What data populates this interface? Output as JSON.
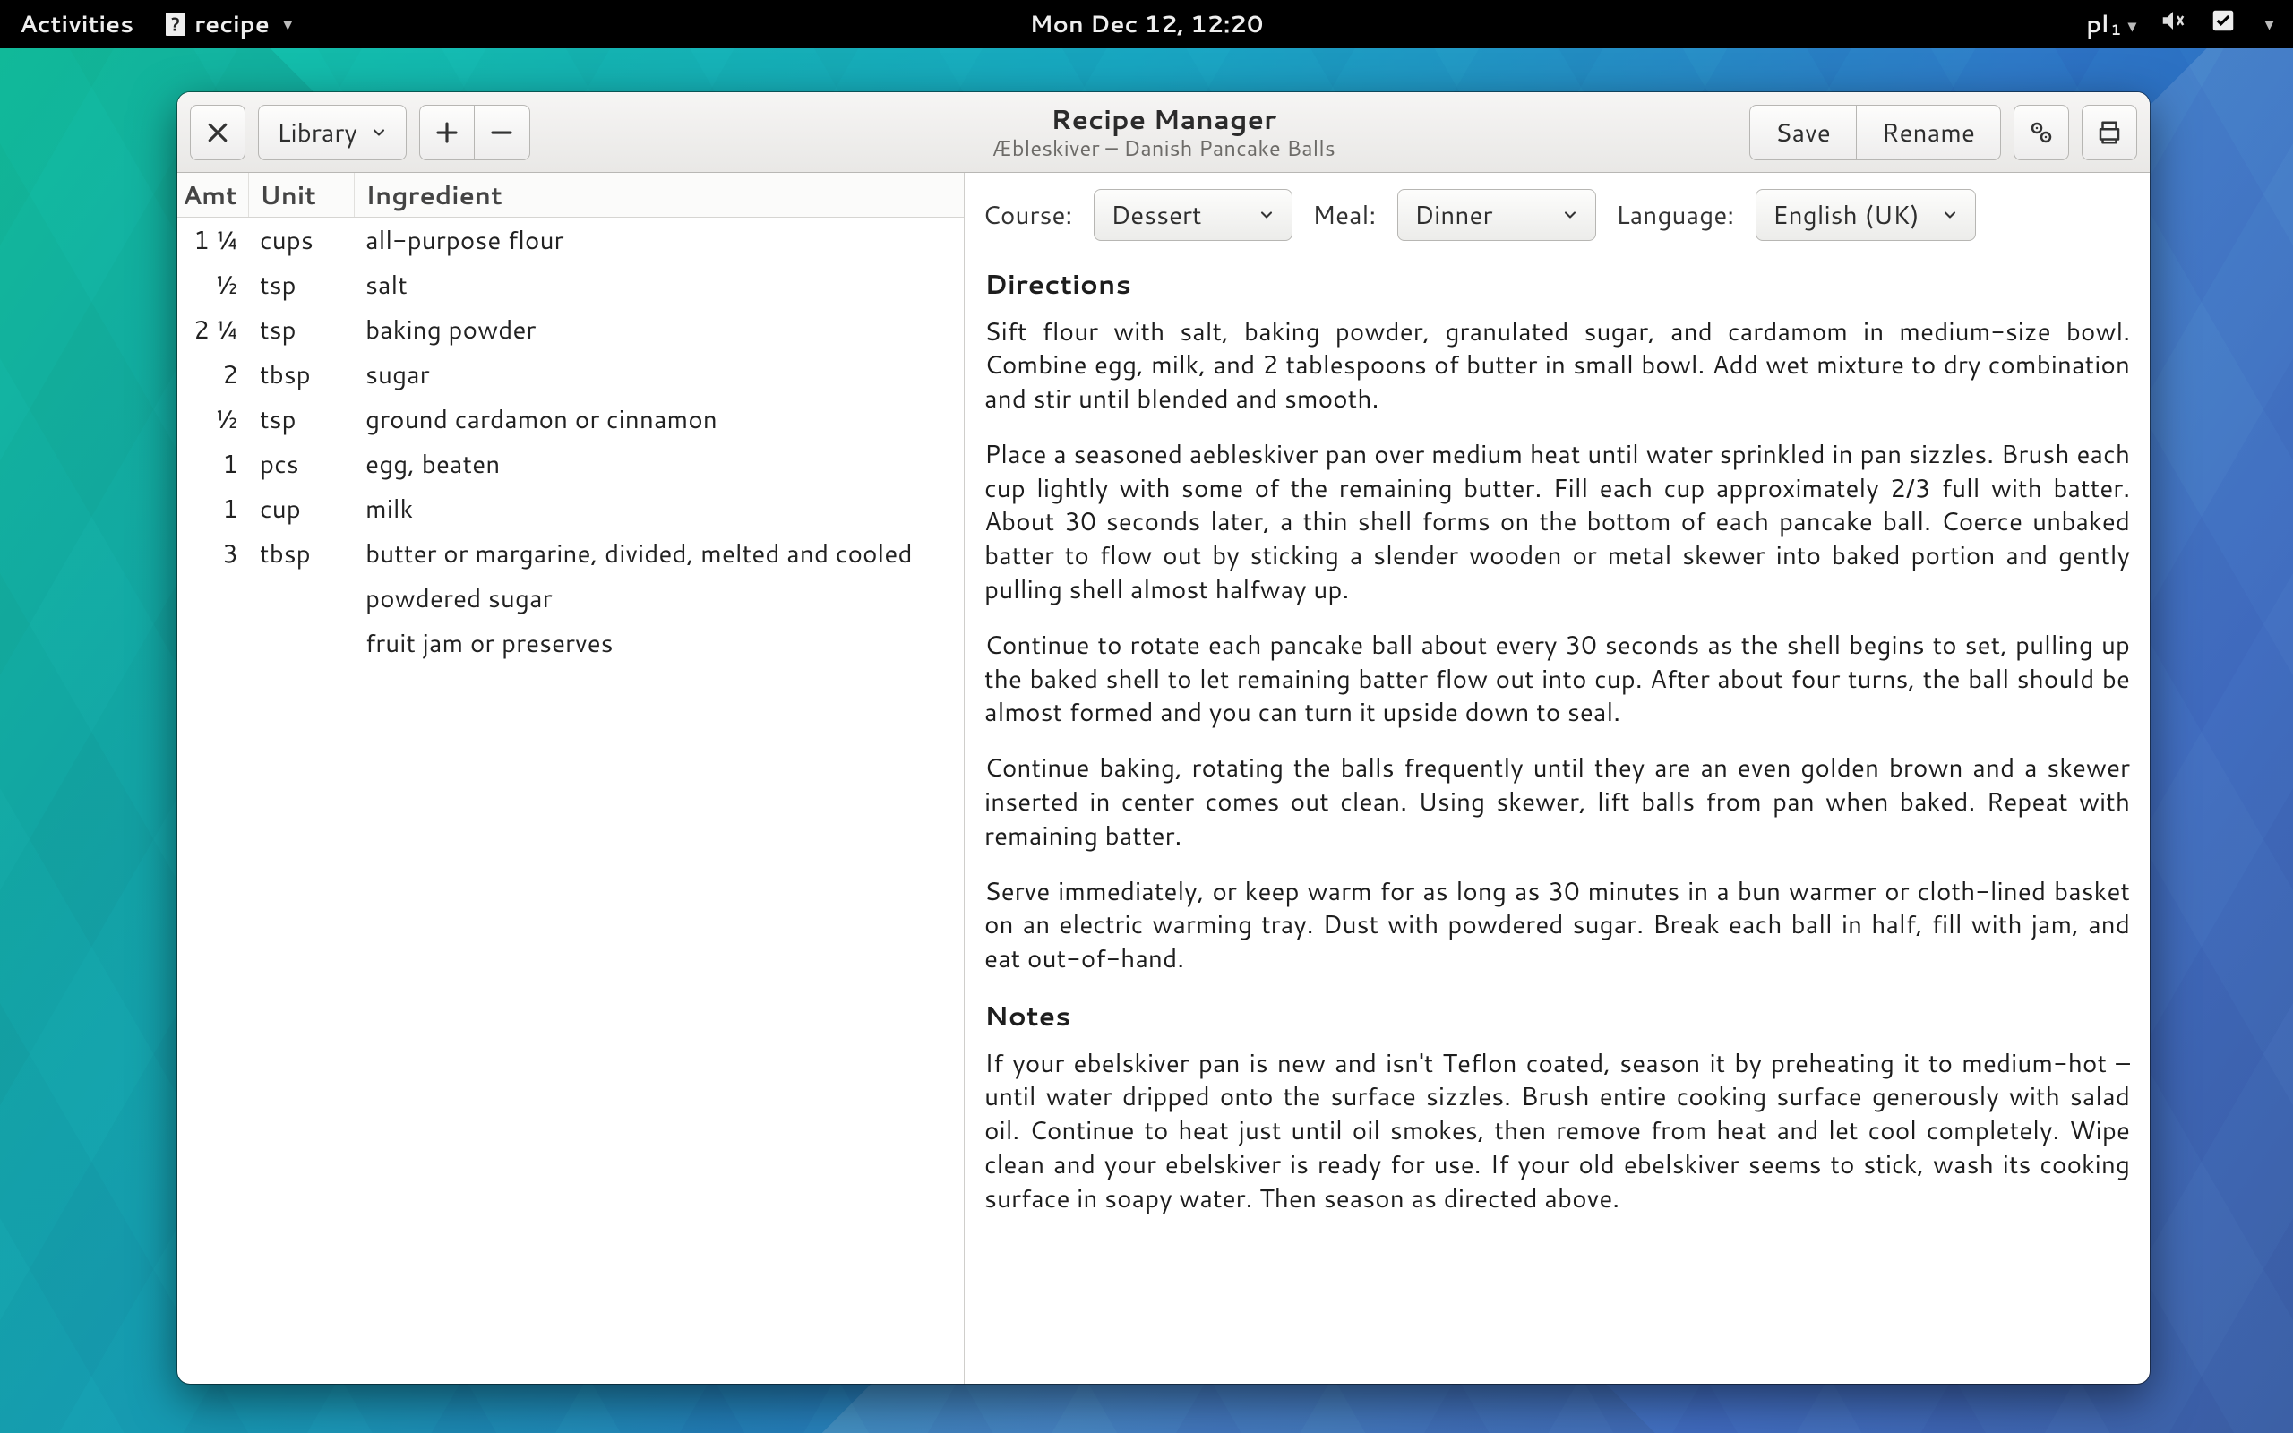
{
  "topbar": {
    "activities": "Activities",
    "app_name": "recipe",
    "clock": "Mon Dec 12, 12:20",
    "keyboard_layout": "pl",
    "keyboard_layout_sub": "1"
  },
  "window": {
    "title": "Recipe Manager",
    "subtitle": "Æbleskiver – Danish Pancake Balls"
  },
  "header": {
    "close": "×",
    "library": "Library",
    "add": "+",
    "remove": "−",
    "save": "Save",
    "rename": "Rename"
  },
  "table": {
    "headers": {
      "amt": "Amt",
      "unit": "Unit",
      "ingredient": "Ingredient"
    },
    "rows": [
      {
        "amt": "1 ¼",
        "unit": "cups",
        "ing": "all-purpose flour"
      },
      {
        "amt": "½",
        "unit": "tsp",
        "ing": "salt"
      },
      {
        "amt": "2 ¼",
        "unit": "tsp",
        "ing": "baking powder"
      },
      {
        "amt": "2",
        "unit": "tbsp",
        "ing": "sugar"
      },
      {
        "amt": "½",
        "unit": "tsp",
        "ing": "ground cardamon or cinnamon"
      },
      {
        "amt": "1",
        "unit": "pcs",
        "ing": "egg, beaten"
      },
      {
        "amt": "1",
        "unit": "cup",
        "ing": "milk"
      },
      {
        "amt": "3",
        "unit": "tbsp",
        "ing": "butter or margarine, divided, melted and cooled"
      },
      {
        "amt": "",
        "unit": "",
        "ing": "powdered sugar"
      },
      {
        "amt": "",
        "unit": "",
        "ing": "fruit jam or preserves"
      }
    ]
  },
  "selectors": {
    "course_label": "Course:",
    "course_value": "Dessert",
    "meal_label": "Meal:",
    "meal_value": "Dinner",
    "language_label": "Language:",
    "language_value": "English (UK)"
  },
  "directions": {
    "heading": "Directions",
    "p1": "Sift flour with salt, baking powder, granulated sugar, and cardamom in medium-size bowl. Combine egg, milk, and 2 tablespoons of butter in small bowl. Add wet mixture to dry combination and stir until blended and smooth.",
    "p2": "Place a seasoned aebleskiver pan over medium heat until water sprinkled in pan sizzles. Brush each cup lightly with some of the remaining butter. Fill each cup approximately 2/3 full with batter. About 30 seconds later, a thin shell forms on the bottom of each pancake ball. Coerce unbaked batter to flow out by sticking a slender wooden or metal skewer into baked portion and gently pulling shell almost halfway up.",
    "p3": "Continue to rotate each pancake ball about every 30 seconds as the shell begins to set, pulling up the baked shell to let remaining batter flow out into cup. After about four turns, the ball should be almost formed and you can turn it upside down to seal.",
    "p4": "Continue baking, rotating the balls frequently until they are an even golden brown and a skewer inserted in center comes out clean. Using skewer, lift balls from pan when baked. Repeat with remaining batter.",
    "p5": "Serve immediately, or keep warm for as long as 30 minutes in a bun warmer or cloth-lined basket on an electric warming tray. Dust with powdered sugar. Break each ball in half, fill with jam, and eat out-of-hand."
  },
  "notes": {
    "heading": "Notes",
    "p1": "If your ebelskiver pan is new and isn't Teflon coated, season it by preheating it to medium-hot – until water dripped onto the surface sizzles. Brush entire cooking surface generously with salad oil. Continue to heat just until oil smokes, then remove from heat and let cool completely. Wipe clean and your ebelskiver is ready for use. If your old ebelskiver seems to stick, wash its cooking surface in soapy water. Then season as directed above."
  }
}
